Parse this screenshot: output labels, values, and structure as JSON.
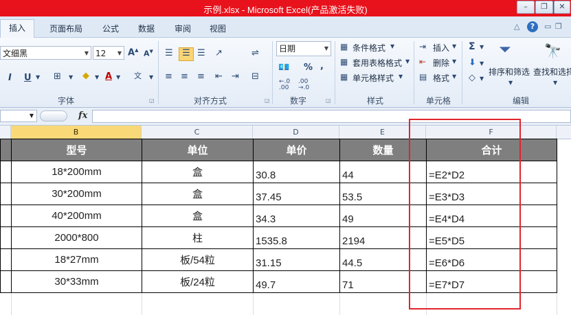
{
  "window": {
    "title": "示例.xlsx - Microsoft Excel(产品激活失败)"
  },
  "tabs": [
    "插入",
    "页面布局",
    "公式",
    "数据",
    "审阅",
    "视图"
  ],
  "font": {
    "name": "文细黑",
    "size": "12"
  },
  "number_format": "日期",
  "styles_items": [
    "条件格式",
    "套用表格格式",
    "单元格样式"
  ],
  "cells_items": [
    "插入",
    "删除",
    "格式"
  ],
  "edit_items": [
    "排序和筛选",
    "查找和选择"
  ],
  "group_labels": [
    "字体",
    "对齐方式",
    "数字",
    "样式",
    "单元格",
    "编辑"
  ],
  "formula_bar": {
    "fx": "fx"
  },
  "columns": [
    "B",
    "C",
    "D",
    "E",
    "F"
  ],
  "table": {
    "headers": [
      "型号",
      "单位",
      "单价",
      "数量",
      "合计"
    ],
    "rows": [
      [
        "18*200mm",
        "盒",
        "30.8",
        "44",
        "=E2*D2"
      ],
      [
        "30*200mm",
        "盒",
        "37.45",
        "53.5",
        "=E3*D3"
      ],
      [
        "40*200mm",
        "盒",
        "34.3",
        "49",
        "=E4*D4"
      ],
      [
        "2000*800",
        "柱",
        "1535.8",
        "2194",
        "=E5*D5"
      ],
      [
        "18*27mm",
        "板/54粒",
        "31.15",
        "44.5",
        "=E6*D6"
      ],
      [
        "30*33mm",
        "板/24粒",
        "49.7",
        "71",
        "=E7*D7"
      ]
    ]
  },
  "colors": {
    "title_bar": "#e8121c",
    "header_fill": "#7f7f7f",
    "highlight_box": "#e0242c",
    "selected_column": "#f9d977"
  }
}
